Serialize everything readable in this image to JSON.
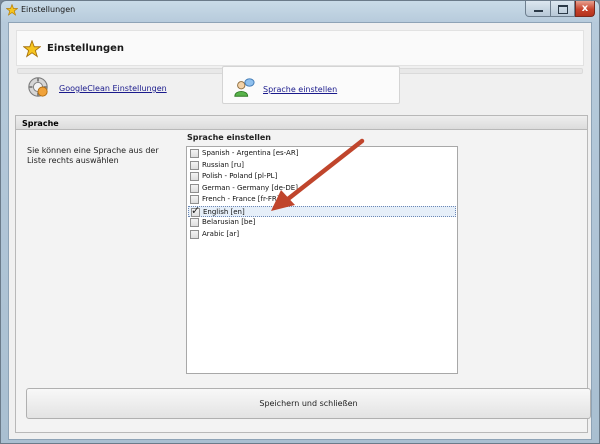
{
  "window": {
    "title": "Einstellungen",
    "close_glyph": "x"
  },
  "header": {
    "title": "Einstellungen",
    "icon": "star-icon"
  },
  "nav": {
    "items": [
      {
        "label": "GoogleClean Einstellungen",
        "icon": "googleclean-settings-icon"
      },
      {
        "label": "Sprache einstellen",
        "icon": "language-users-icon"
      }
    ]
  },
  "section": {
    "title": "Sprache",
    "description": "Sie können eine Sprache aus der Liste rechts auswählen",
    "list_title": "Sprache einstellen",
    "languages": [
      {
        "label": "Spanish - Argentina [es-AR]",
        "checked": false
      },
      {
        "label": "Russian [ru]",
        "checked": false
      },
      {
        "label": "Polish - Poland [pl-PL]",
        "checked": false
      },
      {
        "label": "German - Germany [de-DE]",
        "checked": false
      },
      {
        "label": "French - France [fr-FR]",
        "checked": false
      },
      {
        "label": "English [en]",
        "checked": true
      },
      {
        "label": "Belarusian [be]",
        "checked": false
      },
      {
        "label": "Arabic [ar]",
        "checked": false
      }
    ]
  },
  "actions": {
    "save_label": "Speichern und schließen"
  },
  "colors": {
    "annotation_arrow": "#c0452c",
    "link": "#1a1a8c"
  }
}
